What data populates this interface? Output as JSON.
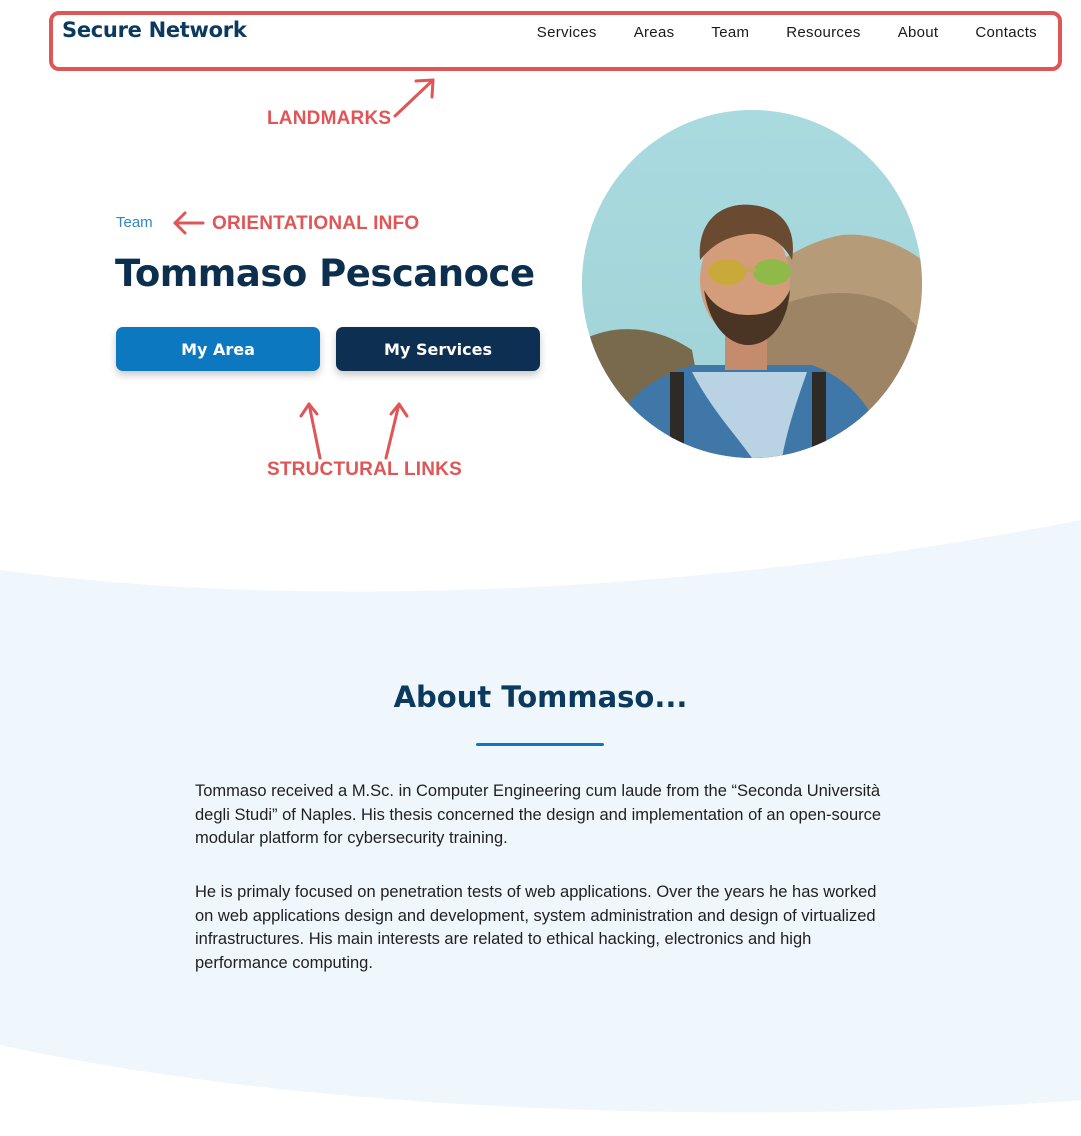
{
  "header": {
    "brand": "Secure Network",
    "nav": [
      "Services",
      "Areas",
      "Team",
      "Resources",
      "About",
      "Contacts"
    ]
  },
  "annotations": {
    "landmarks": "LANDMARKS",
    "orientational": "ORIENTATIONAL INFO",
    "structural": "STRUCTURAL LINKS",
    "color": "#e05555"
  },
  "hero": {
    "breadcrumb": "Team",
    "name": "Tommaso Pescanoce",
    "buttons": {
      "area": "My Area",
      "services": "My Services"
    }
  },
  "about": {
    "title": "About Tommaso...",
    "paragraphs": [
      "Tommaso received a M.Sc. in Computer Engineering cum laude from the “Seconda Università degli Studi” of Naples. His thesis concerned the design and implementation of an open-source modular platform for cybersecurity training.",
      "He is primaly focused on penetration tests of web applications. Over the years he has worked on web applications design and development, system administration and design of virtualized infrastructures. His main interests are related to ethical hacking, electronics and high performance computing."
    ]
  },
  "colors": {
    "accent": "#0b78c0",
    "dark": "#0c2f52",
    "section_bg": "#eff7fd"
  },
  "icons": [
    "user-portrait-photo",
    "arrow-annotation"
  ]
}
